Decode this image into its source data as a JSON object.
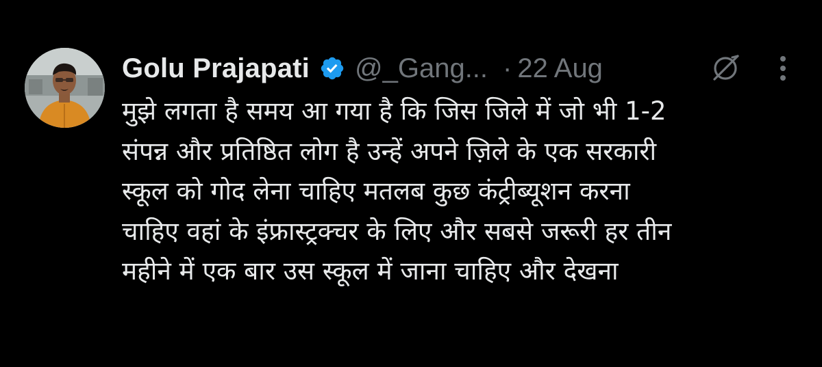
{
  "tweet": {
    "author": {
      "display_name": "Golu Prajapati",
      "handle": "@_Gang...",
      "verified_icon": "verified-badge-icon"
    },
    "separator": "·",
    "date": "22 Aug",
    "lines": [
      "मुझे लगता है समय आ गया है कि जिस जिले में जो भी 1-2",
      "संपन्न और प्रतिष्ठित लोग है उन्हें अपने ज़िले के एक सरकारी",
      "स्कूल को गोद लेना चाहिए मतलब कुछ कंट्रीब्यूशन करना",
      "चाहिए वहां के इंफ्रास्ट्रक्चर के लिए और सबसे जरूरी हर तीन",
      "महीने में एक बार उस स्कूल में जाना चाहिए और देखना"
    ]
  },
  "colors": {
    "background": "#000000",
    "primary_text": "#e7e9ea",
    "secondary_text": "#71767b",
    "verified_blue": "#1d9bf0"
  },
  "icons": {
    "grok": "grok-icon",
    "more": "more-options-icon"
  }
}
